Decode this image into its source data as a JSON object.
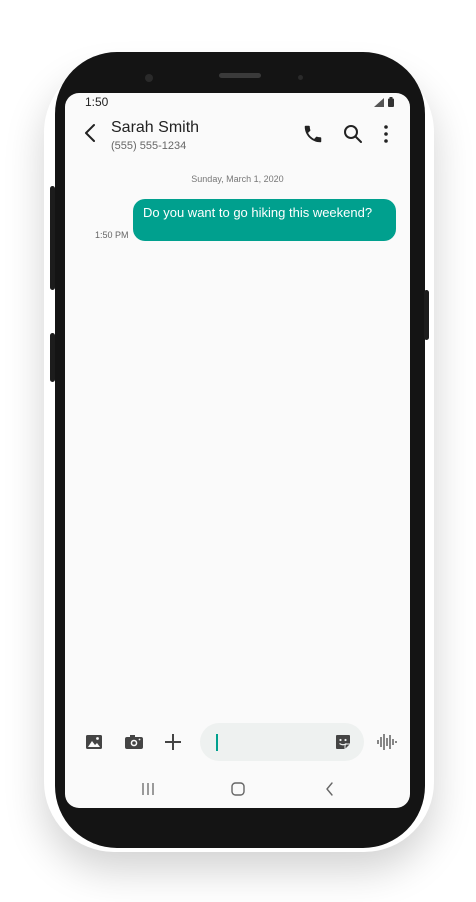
{
  "status_bar": {
    "time": "1:50",
    "icons": [
      "signal-icon",
      "battery-icon"
    ]
  },
  "header": {
    "contact_name": "Sarah Smith",
    "contact_number": "(555) 555-1234",
    "icons": [
      "back-arrow-icon",
      "phone-icon",
      "search-icon",
      "more-vert-icon"
    ]
  },
  "conversation": {
    "date_divider": "Sunday, March 1, 2020",
    "messages": [
      {
        "text": "Do you want to go hiking this weekend?",
        "time": "1:50 PM",
        "direction": "sent"
      }
    ]
  },
  "composer": {
    "input_value": "",
    "icons": [
      "gallery-icon",
      "camera-icon",
      "plus-icon",
      "sticker-icon",
      "voice-wave-icon"
    ]
  },
  "nav_bar": {
    "icons": [
      "recents-icon",
      "home-icon",
      "back-icon"
    ]
  },
  "colors": {
    "accent": "#00a08e",
    "screen_bg": "#fafafa",
    "input_bg": "#eef1f0",
    "phone_body": "#141414"
  }
}
